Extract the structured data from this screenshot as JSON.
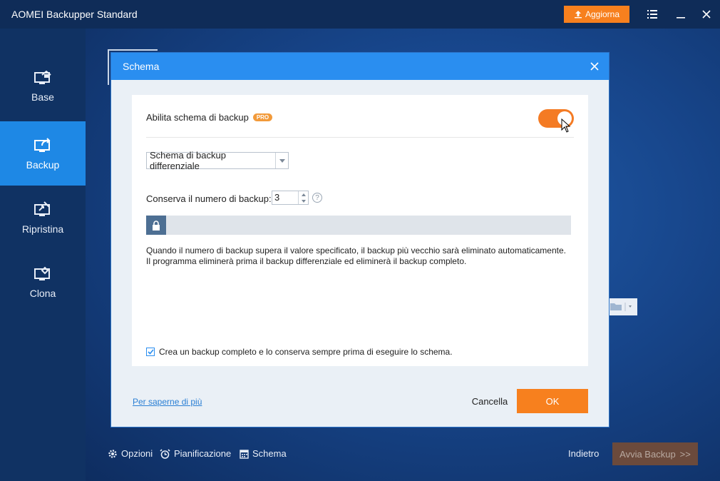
{
  "window": {
    "title": "AOMEI Backupper Standard",
    "upgrade_label": "Aggiorna"
  },
  "sidebar": {
    "items": [
      {
        "label": "Base"
      },
      {
        "label": "Backup"
      },
      {
        "label": "Ripristina"
      },
      {
        "label": "Clona"
      }
    ]
  },
  "dialog": {
    "title": "Schema",
    "enable_label": "Abilita schema di backup",
    "pro_badge": "PRO",
    "scheme_value": "Schema di backup differenziale",
    "keep_label": "Conserva il numero di backup:",
    "keep_value": "3",
    "help_glyph": "?",
    "description_line1": "Quando il numero di backup supera il valore specificato, il backup più vecchio sarà eliminato automaticamente.",
    "description_line2": "Il programma eliminerà prima il backup differenziale ed eliminerà il backup completo.",
    "checkbox_label": "Crea un backup completo e lo conserva sempre prima di eseguire lo schema.",
    "learn_more": "Per saperne di più",
    "cancel_label": "Cancella",
    "ok_label": "OK"
  },
  "bottom": {
    "options": "Opzioni",
    "schedule": "Pianificazione",
    "scheme": "Schema",
    "back": "Indietro",
    "start": "Avvia Backup",
    "start_arrows": ">>"
  },
  "colors": {
    "accent_blue": "#2a8ef0",
    "orange": "#f7801e",
    "sidebar_active": "#1e88e5"
  }
}
